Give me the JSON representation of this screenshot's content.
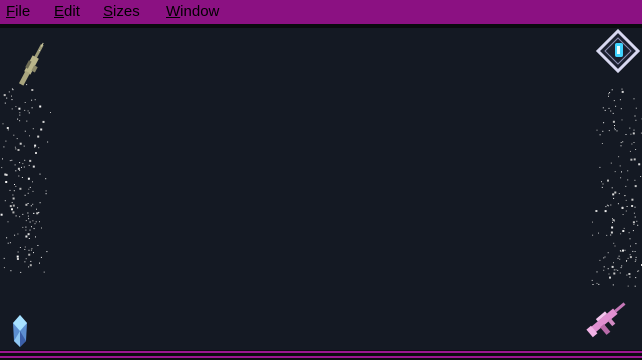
{
  "window": {
    "menu": [
      {
        "id": "file",
        "prefix": "",
        "accel": "F",
        "rest": "ile"
      },
      {
        "id": "edit",
        "prefix": "",
        "accel": "E",
        "rest": "dit"
      },
      {
        "id": "sizes",
        "prefix": "",
        "accel": "S",
        "rest": "izes"
      },
      {
        "id": "window",
        "prefix": "",
        "accel": "W",
        "rest": "indow"
      }
    ]
  },
  "colors": {
    "menubar": "#8b1182",
    "canvas": "#141923",
    "accent_stripe": "#9a1590",
    "rifle_left": "#b9b58a",
    "rifle_right": "#e08fd0",
    "diamond_outline": "#d8d8f0",
    "diamond_fill": "#3fd3ff",
    "crystal": "#7ab8e8"
  },
  "icons": {
    "top_left": "rifle-icon",
    "top_right": "diamond-gem-icon",
    "bottom_left": "crystal-icon",
    "bottom_right": "pink-rifle-icon"
  }
}
